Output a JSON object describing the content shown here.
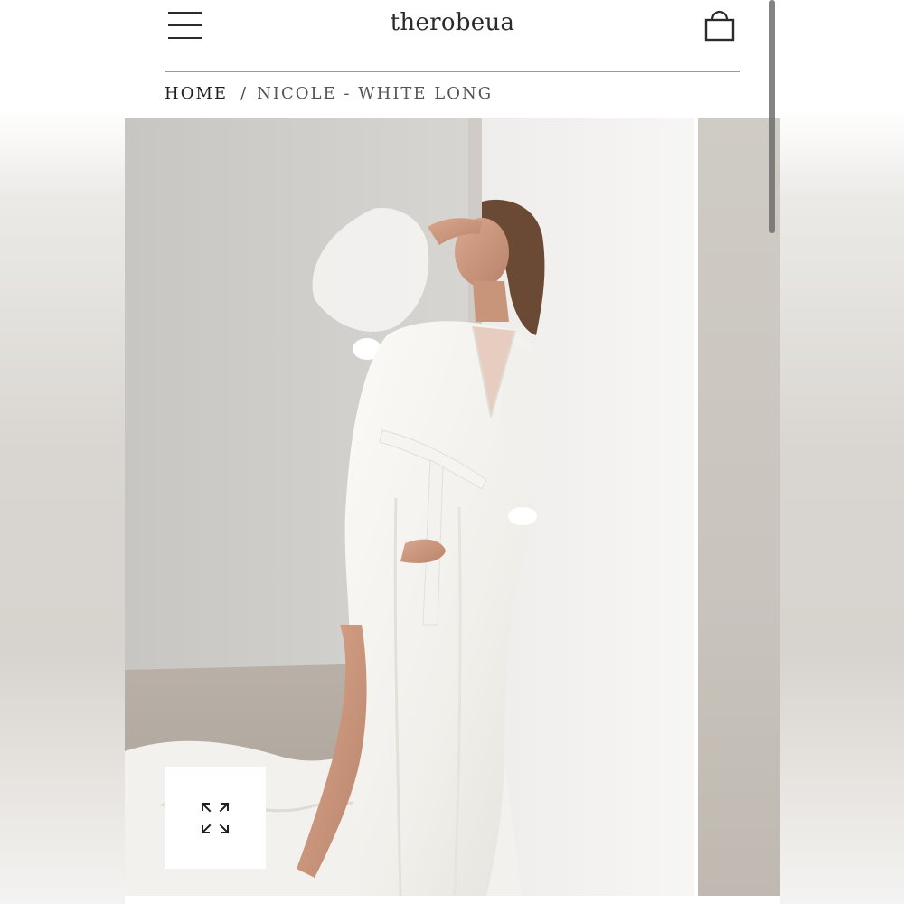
{
  "header": {
    "brand": "therobeua",
    "menu_icon": "hamburger-menu-icon",
    "cart_icon": "shopping-bag-icon"
  },
  "breadcrumb": {
    "home_label": "HOME",
    "separator": "/",
    "current_label": "NICOLE - WHITE LONG"
  },
  "gallery": {
    "main_image": "model-in-white-long-robe-photo",
    "next_image": "next-product-photo-preview",
    "zoom_icon": "expand-arrows-icon"
  },
  "colors": {
    "text": "#2a2a2a",
    "divider": "#9a9a9a",
    "background": "#ffffff"
  }
}
